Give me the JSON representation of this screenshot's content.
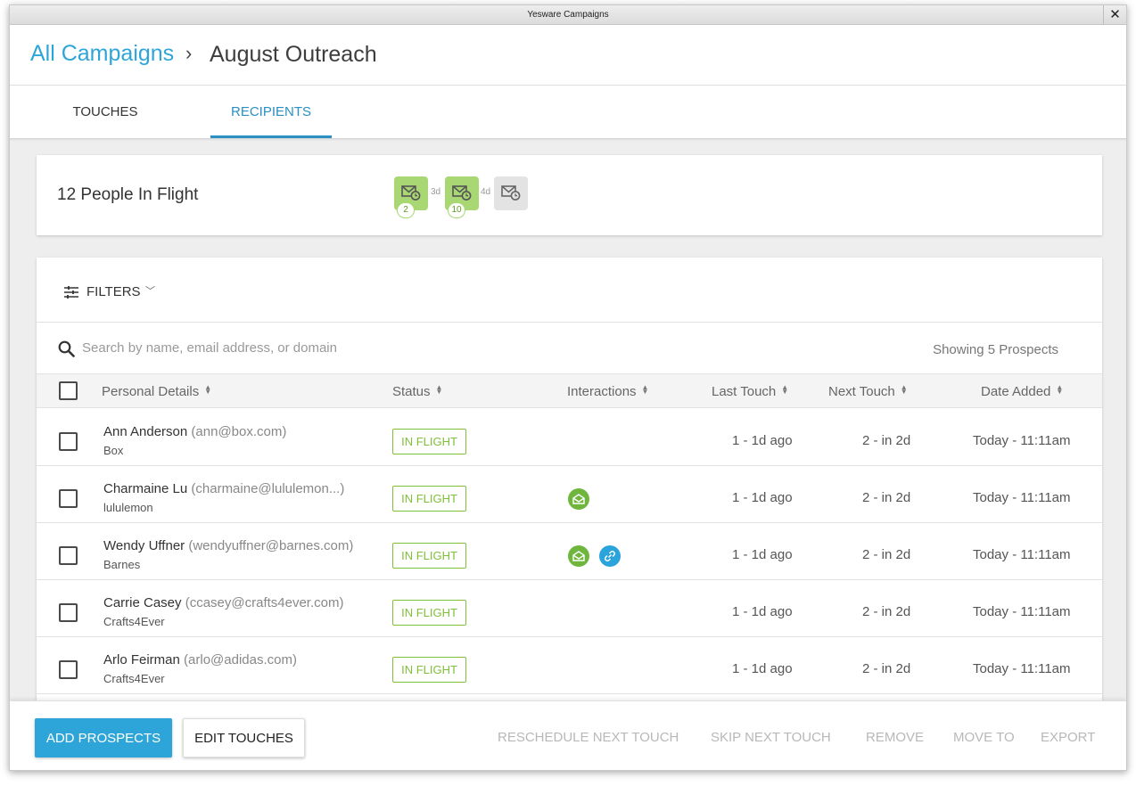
{
  "window": {
    "title": "Yesware Campaigns",
    "close_label": "✕"
  },
  "breadcrumb": {
    "parent": "All Campaigns",
    "separator": "›",
    "current": "August Outreach"
  },
  "tabs": [
    {
      "label": "TOUCHES",
      "active": false
    },
    {
      "label": "RECIPIENTS",
      "active": true
    }
  ],
  "flight": {
    "title": "12 People In Flight",
    "touches": [
      {
        "count": "2",
        "state": "active"
      },
      {
        "count": "10",
        "state": "active"
      },
      {
        "count": "",
        "state": "pending"
      }
    ],
    "gaps": [
      "3d",
      "4d"
    ]
  },
  "filters": {
    "label": "FILTERS"
  },
  "search": {
    "placeholder": "Search by name, email address, or domain",
    "value": ""
  },
  "showing": "Showing 5 Prospects",
  "columns": {
    "personal_details": "Personal Details",
    "status": "Status",
    "interactions": "Interactions",
    "last_touch": "Last Touch",
    "next_touch": "Next Touch",
    "date_added": "Date Added"
  },
  "rows": [
    {
      "name": "Ann Anderson",
      "email": "(ann@box.com)",
      "company": "Box",
      "status": "IN FLIGHT",
      "interactions": [],
      "last_touch": "1 - 1d ago",
      "next_touch": "2 - in 2d",
      "date_added": "Today - 11:11am"
    },
    {
      "name": "Charmaine Lu",
      "email": "(charmaine@lululemon...)",
      "company": "lululemon",
      "status": "IN FLIGHT",
      "interactions": [
        "open-email"
      ],
      "last_touch": "1 - 1d ago",
      "next_touch": "2 - in 2d",
      "date_added": "Today - 11:11am"
    },
    {
      "name": "Wendy Uffner",
      "email": "(wendyuffner@barnes.com)",
      "company": "Barnes",
      "status": "IN FLIGHT",
      "interactions": [
        "open-email",
        "link-click"
      ],
      "last_touch": "1 - 1d ago",
      "next_touch": "2 - in 2d",
      "date_added": "Today - 11:11am"
    },
    {
      "name": "Carrie Casey",
      "email": "(ccasey@crafts4ever.com)",
      "company": "Crafts4Ever",
      "status": "IN FLIGHT",
      "interactions": [],
      "last_touch": "1 - 1d ago",
      "next_touch": "2 - in 2d",
      "date_added": "Today - 11:11am"
    },
    {
      "name": "Arlo Feirman",
      "email": "(arlo@adidas.com)",
      "company": "Crafts4Ever",
      "status": "IN FLIGHT",
      "interactions": [],
      "last_touch": "1 - 1d ago",
      "next_touch": "2 - in 2d",
      "date_added": "Today - 11:11am"
    }
  ],
  "footer": {
    "add_prospects": "ADD PROSPECTS",
    "edit_touches": "EDIT TOUCHES",
    "reschedule": "RESCHEDULE NEXT TOUCH",
    "skip": "SKIP NEXT TOUCH",
    "remove": "REMOVE",
    "move_to": "MOVE TO",
    "export": "EXPORT"
  },
  "colors": {
    "accent": "#2ea5d8",
    "status_green": "#7fbf3a",
    "touch_green": "#a8d774",
    "interaction_green": "#6eb63c",
    "interaction_blue": "#2ba3db"
  },
  "icons": {
    "touch": "email-clock-icon",
    "filters": "sliders-icon",
    "search": "search-icon",
    "open_email": "open-envelope-icon",
    "link_click": "link-icon"
  }
}
